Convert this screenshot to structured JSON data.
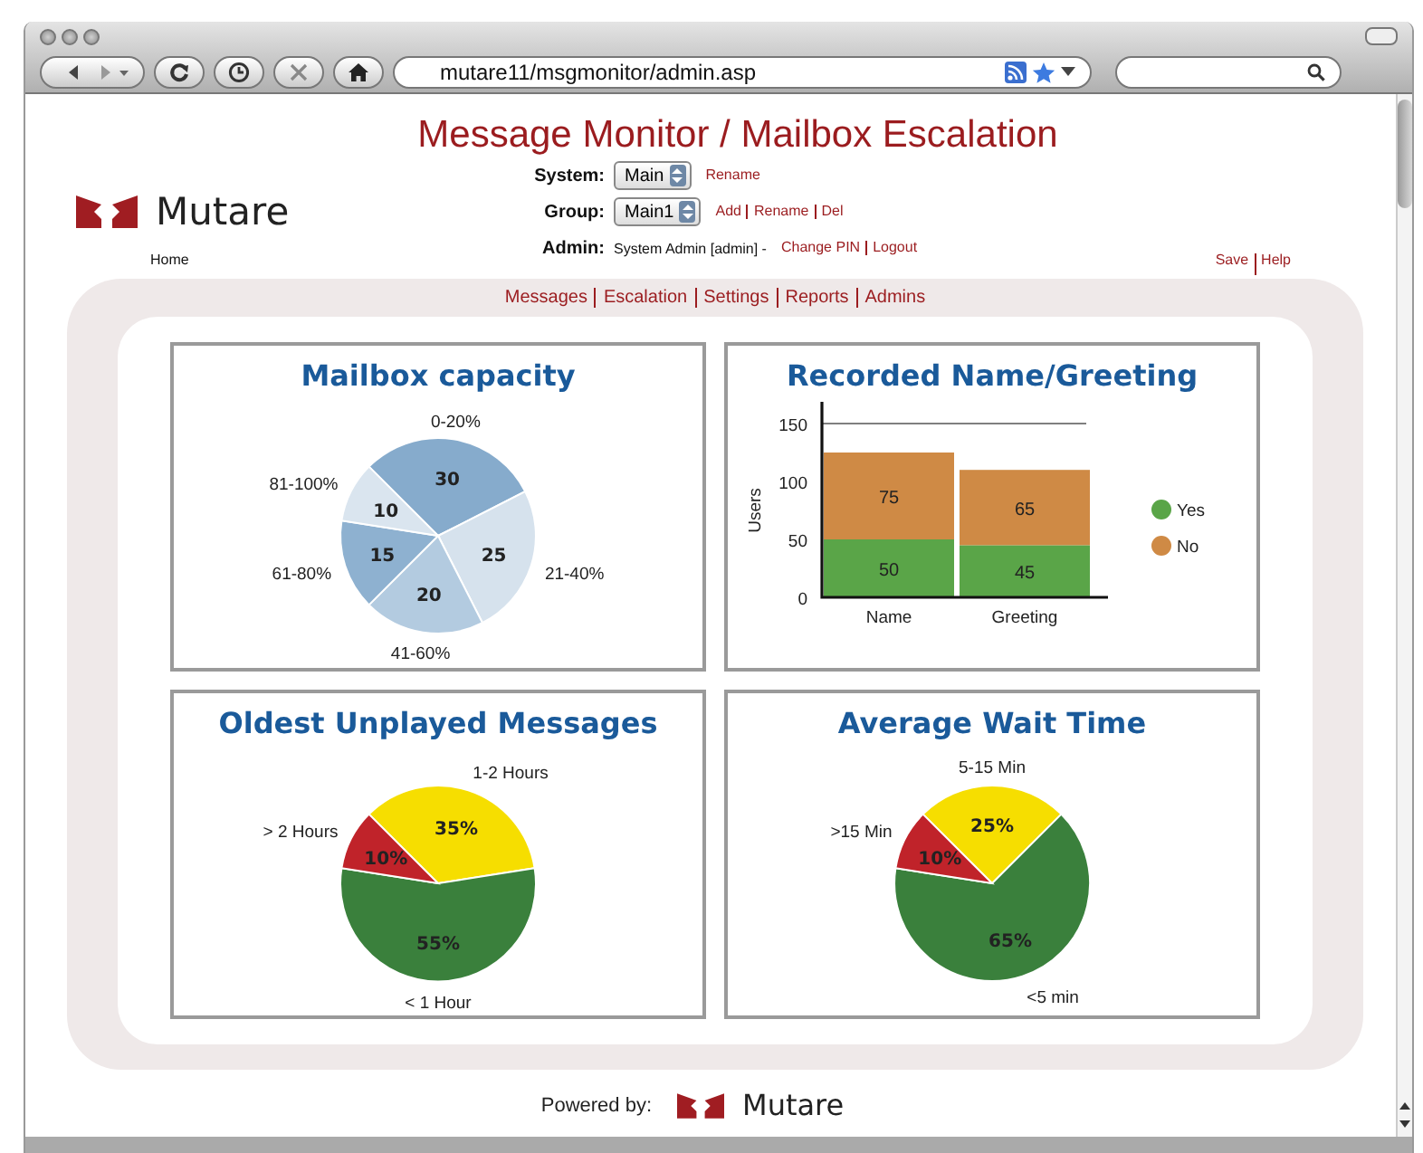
{
  "browser": {
    "url": "mutare11/msgmonitor/admin.asp"
  },
  "header": {
    "title": "Message Monitor / Mailbox Escalation",
    "logo_text": "Mutare",
    "fields": [
      {
        "label": "System:",
        "value": "Main",
        "links": [
          "Rename"
        ]
      },
      {
        "label": "Group:",
        "value": "Main1",
        "links": [
          "Add",
          "Rename",
          "Del"
        ]
      }
    ],
    "admin": {
      "label": "Admin:",
      "text": "System Admin [admin] -",
      "links": [
        "Change PIN",
        "Logout"
      ]
    }
  },
  "top_links": {
    "left": [
      "Home"
    ],
    "right": [
      "Save",
      "Help"
    ]
  },
  "nav": [
    "Messages",
    "Escalation",
    "Settings",
    "Reports",
    "Admins"
  ],
  "panels": [
    {
      "chart_data": {
        "type": "pie",
        "title": "Mailbox capacity",
        "colors": [
          "#86abcc",
          "#d6e2ed",
          "#b3cbe0",
          "#8eb1d0",
          "#dae5ef"
        ],
        "categories": [
          "0-20%",
          "21-40%",
          "41-60%",
          "61-80%",
          "81-100%"
        ],
        "values": [
          30,
          25,
          20,
          15,
          10
        ],
        "data_labels": true
      }
    },
    {
      "chart_data": {
        "type": "bar",
        "title": "Recorded Name/Greeting",
        "ylabel": "Users",
        "categories": [
          "Name",
          "Greeting"
        ],
        "stacked": true,
        "legend": "right",
        "ylim": [
          0,
          150
        ],
        "yticks": [
          0,
          50,
          100,
          150
        ],
        "data_labels": true,
        "series": [
          {
            "name": "Yes",
            "color": "#5aa548",
            "values": [
              50,
              45
            ]
          },
          {
            "name": "No",
            "color": "#cf8a45",
            "values": [
              75,
              65
            ]
          }
        ]
      }
    },
    {
      "chart_data": {
        "type": "pie",
        "title": "Oldest Unplayed Messages",
        "colors": [
          "#f6de00",
          "#3a803c",
          "#c0232a"
        ],
        "categories": [
          "1-2 Hours",
          "< 1 Hour",
          "> 2 Hours"
        ],
        "values": [
          35,
          55,
          10
        ],
        "value_labels": [
          "35%",
          "55%",
          "10%"
        ]
      }
    },
    {
      "chart_data": {
        "type": "pie",
        "title": "Average Wait Time",
        "colors": [
          "#f6de00",
          "#3a803c",
          "#c0232a"
        ],
        "categories": [
          "5-15 Min",
          "<5 min",
          ">15 Min"
        ],
        "values": [
          25,
          65,
          10
        ],
        "value_labels": [
          "25%",
          "65%",
          "10%"
        ]
      }
    }
  ],
  "footer": {
    "label": "Powered by:",
    "logo_text": "Mutare"
  }
}
